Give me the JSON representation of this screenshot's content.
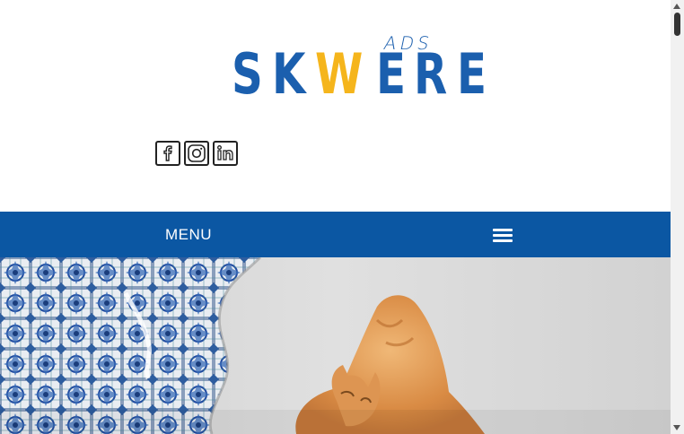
{
  "logo": {
    "ads": "ADS",
    "word": [
      {
        "text": "S",
        "color": "#1b5fae"
      },
      {
        "text": "K",
        "color": "#1b5fae"
      },
      {
        "text": "W",
        "color": "#f5b51c"
      },
      {
        "text": "E",
        "color": "#1b5fae"
      },
      {
        "text": "R",
        "color": "#1b5fae"
      },
      {
        "text": "E",
        "color": "#1b5fae"
      }
    ]
  },
  "social": [
    "facebook-icon",
    "instagram-icon",
    "linkedin-icon"
  ],
  "menu": {
    "label": "MENU",
    "background": "#0b57a3"
  },
  "colors": {
    "brand_blue": "#1b5fae",
    "brand_yellow": "#f5b51c"
  }
}
